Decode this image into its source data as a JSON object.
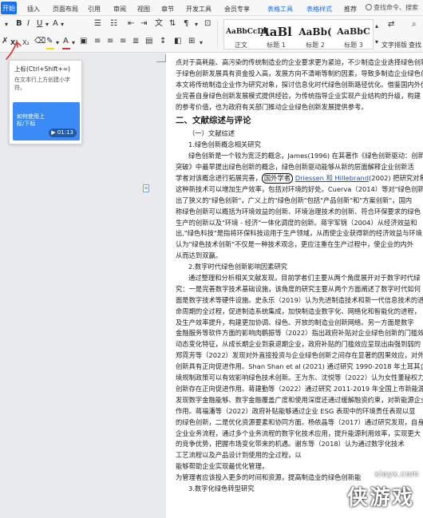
{
  "menubar": {
    "items": [
      "开始",
      "插入",
      "页面布局",
      "引用",
      "审阅",
      "视图",
      "章节",
      "开发工具",
      "会员专享",
      "表格工具",
      "表格样式",
      "推荐"
    ],
    "search_placeholder": "查找命令、搜索"
  },
  "ribbon": {
    "superscript_icon": "X²",
    "subscript_icon": "X₂",
    "font_a": "A",
    "styles": [
      {
        "preview": "AaBbCcDd",
        "label": "正文"
      },
      {
        "preview": "AaBl",
        "label": "标题 1"
      },
      {
        "preview": "AaBb(",
        "label": "标题 2"
      },
      {
        "preview": "AaBbC",
        "label": "标题 3"
      }
    ],
    "text_tools_label": "文字排版",
    "find_label": "查找替"
  },
  "tooltip": {
    "title": "上标(Ctrl+Shift+=)",
    "description": "在文本行上方创建小字符。",
    "card_text": "如何使用上标/下标",
    "duration": "01:13"
  },
  "document": {
    "lines": [
      {
        "text": "点对于高耗能、高污染的传统制造业的企业要求更为紧迫，不少制造企业迭择绿色创新",
        "cls": ""
      },
      {
        "text": "于绿色创新发展具有资金投入高，发展方向不清晰等制约因素，导致多制造企业绿色创",
        "cls": ""
      },
      {
        "text": "本文将传统制造企业作为研究对象，探讨信息化时代绿色创新路径优化。借鉴国内外优",
        "cls": ""
      },
      {
        "text": "业完善自身绿色创新发展模式提供经验，为传统指导企业实现产业结构的升级，构建",
        "cls": ""
      },
      {
        "text": "的参考价值，也为政府有关部门推动企业绿色创新发展提供参考。",
        "cls": ""
      },
      {
        "text": "二、文献综述与评论",
        "cls": "h2"
      },
      {
        "text": "（一）文献综述",
        "cls": "ind"
      },
      {
        "text": "1.绿色创新概念相关研究",
        "cls": "ind"
      },
      {
        "text": "绿色创新是一个较为宽泛的概念，James(1996) 在其著作《绿色创新驱动：创新",
        "cls": "ind"
      },
      {
        "text": "突破》中最早提出绿色创新的概念，绿色创新驱动能够从新的层面解释企业创新活",
        "cls": ""
      },
      {
        "text": "学者对该概念进行拓展完善，国外学者 Driessen 和 Hillebrand(2002) 把研究对象",
        "cls": "",
        "highlight": "国外学者"
      },
      {
        "text": "这种新技术可以增加生产效率，包括对环境的好处。Cuerva（2014）等对\"绿色创新",
        "cls": ""
      },
      {
        "text": "出了狭义的\"绿色创新\"，广义上的\"绿色创新\"包括\"产品创新\"和\"方案创新\"，国内",
        "cls": ""
      },
      {
        "text": "称绿色创新可以概括为环境效益的创新、环境治理技术的创新、符合环保要求的绿色",
        "cls": ""
      },
      {
        "text": "生产的创新以及\"环境 - 经济\"一体化调度的创新。蒋宇军锦（2004）从经济效益和",
        "cls": ""
      },
      {
        "text": "出,\"绿色科技\"是指将环保科技运用于生产领域，从而使企业获得新的经济效益与环境",
        "cls": ""
      },
      {
        "text": "认为\"绿色技术创新\"不仅是一种技术观念，更应注重在生产过程中，使企业的内外",
        "cls": ""
      },
      {
        "text": "从而达到双赢。",
        "cls": ""
      },
      {
        "text": "2.数字时代绿色创新影响因素研究",
        "cls": "ind"
      },
      {
        "text": "通过整理和分析相关文献发现，目前学者们主要从两个角度展开对于数字时代绿",
        "cls": "ind"
      },
      {
        "text": "究：一是完善数字技术基础设施，该角度的研究主要从两个方面阐述了数字时代如何",
        "cls": ""
      },
      {
        "text": "面是数字技术等硬件设施。史永乐（2019）认为先进制造技术和新一代信息技术的进",
        "cls": ""
      },
      {
        "text": "命周期的全过程，促进制造系统集成，加快制造业数字化、网络化和智能化的进程，",
        "cls": ""
      },
      {
        "text": "及生产效率提升，构建更加协调、绿色、开放的制造业创新网络。另一方面是数字",
        "cls": ""
      },
      {
        "text": "金融服务等软件方面的影响肉鹏振等（2022）指出政府补贴对企业绿色创新的门槛效",
        "cls": ""
      },
      {
        "text": "动态变化特征，从成长期企业到衰退期企业，政府补贴的门槛效应呈现出由强到弱的",
        "cls": ""
      },
      {
        "text": "郑霓芳等（2022）发现对外直接投资与企业绿色创新之间存在显著的因果效应，对外",
        "cls": ""
      },
      {
        "text": "创新具有正向促进作用。Shan Shan et al (2021) 通过研究 1990-2018 年土耳其企业的",
        "cls": ""
      },
      {
        "text": "境规制政策可以有效影响绿色技术创新。王为东、沈悦等（2022）认为女性董秘权力",
        "cls": ""
      },
      {
        "text": "创新存在正向促进作用。蒋建勤等（2022）通过研究 2011-2019 年全国上市新能源",
        "cls": ""
      },
      {
        "text": "发现数字金融能够、数字金融覆盖广度和使用深度还通过缓解融资约束，对新能源企业",
        "cls": ""
      },
      {
        "text": "作用。蒋福潘等（2022）政府补贴能够通过企业 ESG 表现中的环境责任表现以显",
        "cls": ""
      },
      {
        "text": "的绿色创新，二是优化资源要素和协同方面。杨依晶等（2017）通过研究发现，自身",
        "cls": ""
      },
      {
        "text": "企业业务流程，通过多个业务流程的数字化技术应用，提升能源利用效率，实现更大",
        "cls": ""
      },
      {
        "text": "的竞争优势，把握市场变化带来的机遇。谢东等（2018）认为通过数字化技术",
        "cls": ""
      },
      {
        "text": "工艺流程以及产品设计到使用的全过程，以",
        "cls": ""
      },
      {
        "text": "能够帮助企业实现最优化管理，",
        "cls": ""
      },
      {
        "text": "为管理者应该投入更多的时间和资源，提高制造业的绿色创新能",
        "cls": ""
      },
      {
        "text": "3.数字化绿色转型研究",
        "cls": "ind"
      }
    ]
  },
  "watermark": {
    "url": "xiayx.com",
    "text": "侠游戏"
  },
  "colors": {
    "accent": "#1b6ff5",
    "annotation_red": "#e03131",
    "tooltip_card": "#3a8bf5"
  }
}
